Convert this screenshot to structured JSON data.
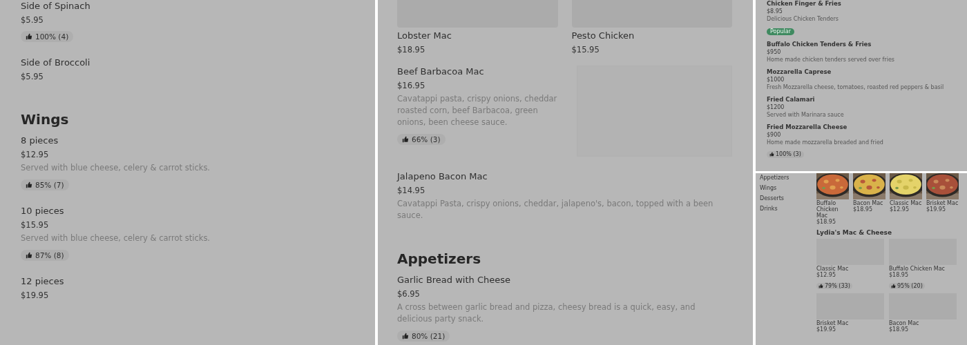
{
  "panels": [
    {
      "kind": "list",
      "entries": [
        {
          "kind": "item",
          "name": "Side of Spinach",
          "price": "$5.95",
          "rating": "100% (4)"
        },
        {
          "kind": "item",
          "name": "Side of Broccoli",
          "price": "$5.95"
        },
        {
          "kind": "heading",
          "title": "Wings"
        },
        {
          "kind": "item",
          "name": "8 pieces",
          "price": "$12.95",
          "description": "Served with blue cheese, celery & carrot sticks.",
          "rating": "85% (7)"
        },
        {
          "kind": "item",
          "name": "10 pieces",
          "price": "$15.95",
          "description": "Served with blue cheese, celery & carrot sticks.",
          "rating": "87% (8)"
        },
        {
          "kind": "item",
          "name": "12 pieces",
          "price": "$19.95"
        }
      ]
    },
    {
      "kind": "list",
      "entries": [
        {
          "kind": "cards",
          "cards": [
            {
              "name": "Lobster Mac",
              "price": "$18.95"
            },
            {
              "name": "Pesto Chicken",
              "price": "$15.95"
            }
          ]
        },
        {
          "kind": "item",
          "name": "Beef Barbacoa Mac",
          "price": "$16.95",
          "description": "Cavatappi pasta, crispy onions, cheddar roasted corn, beef Barbacoa, green onions, been cheese sauce.",
          "rating": "66% (3)",
          "image": true
        },
        {
          "kind": "item",
          "name": "Jalapeno Bacon Mac",
          "price": "$14.95",
          "description": "Cavatappi Pasta, crispy onions, cheddar, jalapeno's, bacon, topped with a been sauce."
        },
        {
          "kind": "heading",
          "title": "Appetizers"
        },
        {
          "kind": "item",
          "name": "Garlic Bread with Cheese",
          "price": "$6.95",
          "description": "A cross between garlic bread and pizza, cheesy bread is a quick, easy, and delicious party snack.",
          "rating": "80% (21)"
        }
      ]
    },
    {
      "kind": "compact_list",
      "entries": [
        {
          "kind": "item",
          "name": "Chicken Finger & Fries",
          "price": "$8.95",
          "description": "Delicious Chicken Tenders",
          "badge": "Popular"
        },
        {
          "kind": "item",
          "name": "Buffalo Chicken Tenders & Fries",
          "price": "$950",
          "description": "Home made chicken tenders served over fries"
        },
        {
          "kind": "item",
          "name": "Mozzarella Caprese",
          "price": "$1000",
          "description": "Fresh Mozzarella cheese, tomatoes, roasted red peppers & basil"
        },
        {
          "kind": "item",
          "name": "Fried Calamari",
          "price": "$1200",
          "description": "Served with Marinara sauce"
        },
        {
          "kind": "item",
          "name": "Fried Mozzarella Cheese",
          "price": "$900",
          "description": "Home made mozzarella breaded and fried",
          "rating": "100% (3)"
        }
      ]
    },
    {
      "kind": "store_page",
      "sidebar": [
        "Appetizers",
        "Wings",
        "Desserts",
        "Drinks"
      ],
      "featured": [
        {
          "name": "Buffalo Chicken Mac",
          "price": "$18.95"
        },
        {
          "name": "Bacon Mac",
          "price": "$18.95"
        },
        {
          "name": "Classic Mac",
          "price": "$12.95"
        },
        {
          "name": "Brisket Mac",
          "price": "$19.95"
        }
      ],
      "section_title": "Lydia's Mac & Cheese",
      "grid": [
        {
          "name": "Classic Mac",
          "price": "$12.95",
          "rating": "79% (33)"
        },
        {
          "name": "Buffalo Chicken Mac",
          "price": "$18.95",
          "rating": "95% (20)"
        },
        {
          "name": "Brisket Mac",
          "price": "$19.95"
        },
        {
          "name": "Bacon Mac",
          "price": "$18.95"
        }
      ]
    }
  ]
}
